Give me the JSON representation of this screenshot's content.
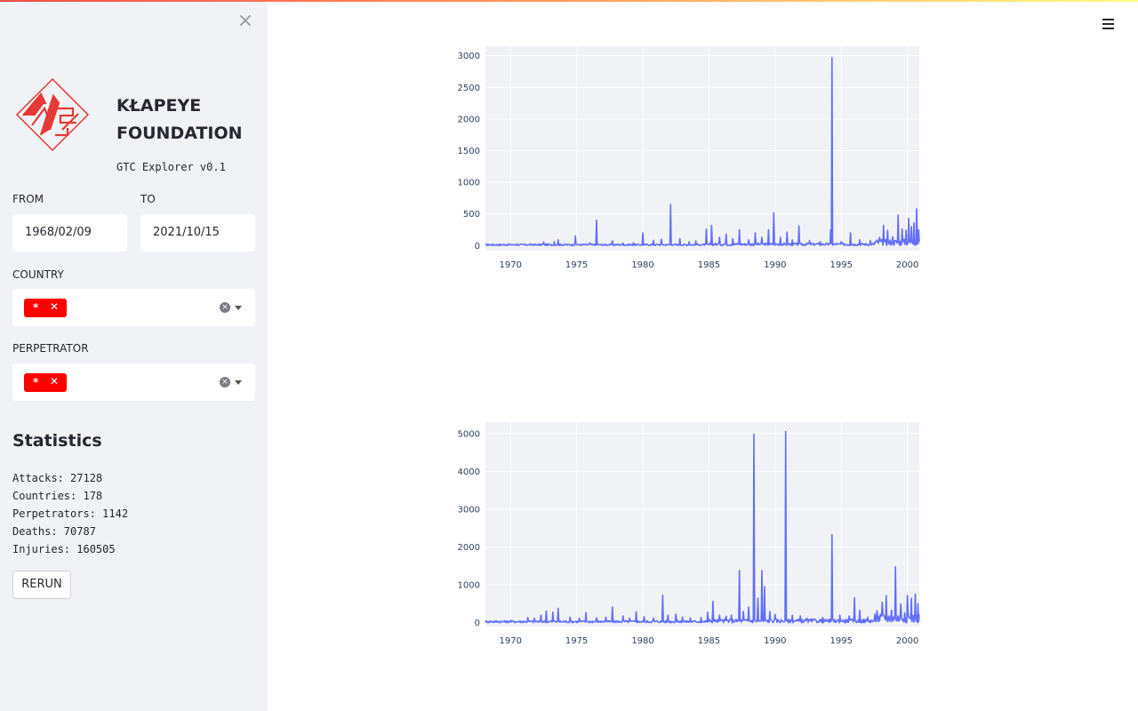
{
  "sidebar": {
    "close_label": "×",
    "brand": [
      "KŁAPEYE",
      "FOUNDATION"
    ],
    "version": "GTC Explorer v0.1",
    "from_label": "FROM",
    "from_value": "1968/02/09",
    "to_label": "TO",
    "to_value": "2021/10/15",
    "country_label": "COUNTRY",
    "country_tag": "*",
    "perpetrator_label": "PERPETRATOR",
    "perpetrator_tag": "*",
    "tag_remove": "✕",
    "stats_title": "Statistics",
    "stats": [
      "Attacks: 27128",
      "Countries: 178",
      "Perpetrators: 1142",
      "Deaths: 70787",
      "Injuries: 160505"
    ],
    "rerun_label": "RERUN"
  },
  "colors": {
    "accent": "#ff4b4b",
    "series": "#636efa",
    "plot_bg": "#f0f2f6",
    "tag": "#ff0000"
  },
  "icons": {
    "close": "close-icon",
    "menu": "hamburger-menu-icon",
    "clear": "clear-selection-icon",
    "dropdown": "chevron-down-icon"
  },
  "chart_data": [
    {
      "type": "line",
      "x_range": [
        1968.1,
        2000.9
      ],
      "ylim": [
        -80,
        3150
      ],
      "x_ticks": [
        1970,
        1975,
        1980,
        1985,
        1990,
        1995,
        2000
      ],
      "y_ticks": [
        0,
        500,
        1000,
        1500,
        2000,
        2500,
        3000
      ],
      "grid": true,
      "baseline_noise": 25,
      "spikes": [
        [
          1970.5,
          25
        ],
        [
          1972.5,
          55
        ],
        [
          1973.3,
          60
        ],
        [
          1973.6,
          90
        ],
        [
          1974.9,
          150
        ],
        [
          1976.0,
          45
        ],
        [
          1976.5,
          400
        ],
        [
          1977.7,
          75
        ],
        [
          1978.5,
          40
        ],
        [
          1979.3,
          45
        ],
        [
          1980.0,
          200
        ],
        [
          1980.8,
          80
        ],
        [
          1981.4,
          100
        ],
        [
          1982.1,
          650
        ],
        [
          1982.8,
          110
        ],
        [
          1983.5,
          60
        ],
        [
          1984.0,
          75
        ],
        [
          1984.8,
          260
        ],
        [
          1985.2,
          320
        ],
        [
          1985.8,
          130
        ],
        [
          1986.3,
          180
        ],
        [
          1986.8,
          110
        ],
        [
          1987.3,
          250
        ],
        [
          1988.0,
          90
        ],
        [
          1988.5,
          200
        ],
        [
          1989.0,
          130
        ],
        [
          1989.5,
          250
        ],
        [
          1989.9,
          520
        ],
        [
          1990.4,
          130
        ],
        [
          1990.9,
          210
        ],
        [
          1991.3,
          90
        ],
        [
          1991.8,
          310
        ],
        [
          1992.6,
          80
        ],
        [
          1993.4,
          60
        ],
        [
          1994.2,
          250
        ],
        [
          1994.3,
          2970
        ],
        [
          1995.0,
          60
        ],
        [
          1995.7,
          200
        ],
        [
          1996.4,
          90
        ],
        [
          1997.2,
          80
        ],
        [
          1997.9,
          130
        ],
        [
          1998.2,
          320
        ],
        [
          1998.5,
          240
        ],
        [
          1998.9,
          140
        ],
        [
          1999.3,
          480
        ],
        [
          1999.6,
          260
        ],
        [
          1999.9,
          240
        ],
        [
          2000.1,
          430
        ],
        [
          2000.3,
          300
        ],
        [
          2000.5,
          360
        ],
        [
          2000.7,
          580
        ],
        [
          2000.85,
          250
        ]
      ]
    },
    {
      "type": "line",
      "x_range": [
        1968.1,
        2000.9
      ],
      "ylim": [
        -100,
        5300
      ],
      "x_ticks": [
        1970,
        1975,
        1980,
        1985,
        1990,
        1995,
        2000
      ],
      "y_ticks": [
        0,
        1000,
        2000,
        3000,
        4000,
        5000
      ],
      "grid": true,
      "baseline_noise": 60,
      "spikes": [
        [
          1970.0,
          60
        ],
        [
          1971.3,
          140
        ],
        [
          1971.8,
          120
        ],
        [
          1972.3,
          200
        ],
        [
          1972.7,
          310
        ],
        [
          1973.2,
          280
        ],
        [
          1973.6,
          380
        ],
        [
          1974.5,
          150
        ],
        [
          1975.2,
          120
        ],
        [
          1975.7,
          270
        ],
        [
          1976.5,
          130
        ],
        [
          1977.2,
          150
        ],
        [
          1977.7,
          420
        ],
        [
          1978.5,
          180
        ],
        [
          1979.0,
          120
        ],
        [
          1979.5,
          290
        ],
        [
          1980.1,
          160
        ],
        [
          1980.8,
          120
        ],
        [
          1981.5,
          730
        ],
        [
          1981.9,
          200
        ],
        [
          1982.5,
          230
        ],
        [
          1983.0,
          150
        ],
        [
          1983.6,
          130
        ],
        [
          1984.4,
          140
        ],
        [
          1984.9,
          280
        ],
        [
          1985.3,
          570
        ],
        [
          1985.8,
          200
        ],
        [
          1986.3,
          170
        ],
        [
          1986.7,
          200
        ],
        [
          1987.3,
          1380
        ],
        [
          1987.6,
          300
        ],
        [
          1988.0,
          420
        ],
        [
          1988.4,
          4980
        ],
        [
          1988.7,
          650
        ],
        [
          1989.0,
          1380
        ],
        [
          1989.2,
          960
        ],
        [
          1989.6,
          300
        ],
        [
          1990.0,
          220
        ],
        [
          1990.8,
          5050
        ],
        [
          1991.3,
          200
        ],
        [
          1991.9,
          180
        ],
        [
          1992.4,
          120
        ],
        [
          1993.0,
          100
        ],
        [
          1993.6,
          140
        ],
        [
          1994.3,
          2330
        ],
        [
          1994.9,
          200
        ],
        [
          1995.6,
          180
        ],
        [
          1996.0,
          660
        ],
        [
          1996.4,
          330
        ],
        [
          1997.0,
          150
        ],
        [
          1997.7,
          320
        ],
        [
          1998.1,
          540
        ],
        [
          1998.4,
          720
        ],
        [
          1998.8,
          330
        ],
        [
          1999.1,
          1480
        ],
        [
          1999.5,
          500
        ],
        [
          1999.8,
          260
        ],
        [
          2000.0,
          720
        ],
        [
          2000.3,
          650
        ],
        [
          2000.6,
          760
        ],
        [
          2000.8,
          500
        ]
      ]
    }
  ]
}
